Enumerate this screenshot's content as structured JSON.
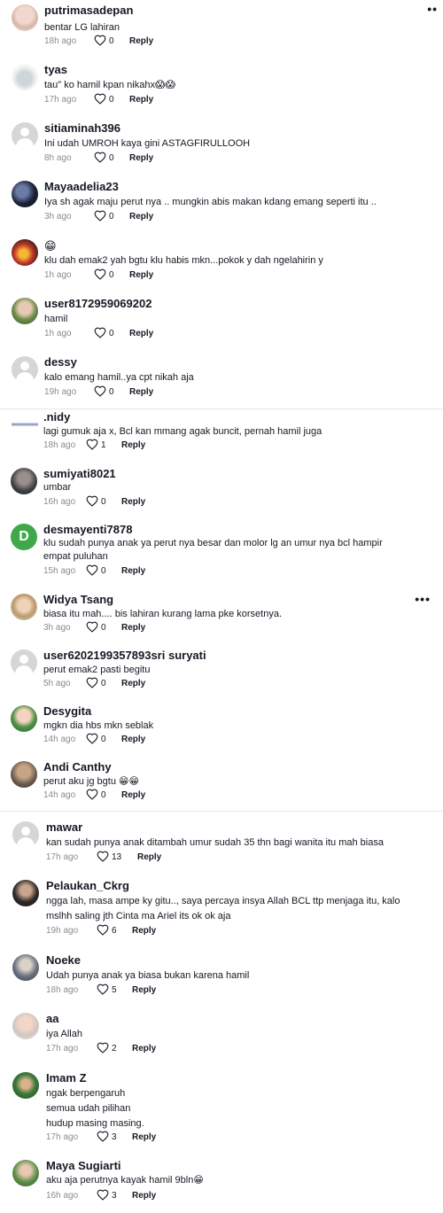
{
  "reply_label": "Reply",
  "comments": [
    {
      "username": "putrimasadepan",
      "text": [
        "bentar LG lahiran"
      ],
      "time": "18h ago",
      "likes": "0",
      "avatar": "pink"
    },
    {
      "username": "tyas",
      "text": [
        "tau\" ko hamil kpan nikahx😱😱"
      ],
      "time": "17h ago",
      "likes": "0",
      "avatar": "tyas"
    },
    {
      "username": "sitiaminah396",
      "text": [
        "Ini udah UMROH kaya gini ASTAGFIRULLOOH"
      ],
      "time": "8h ago",
      "likes": "0",
      "avatar": "gray"
    },
    {
      "username": "Mayaadelia23",
      "text": [
        "Iya sh agak maju perut nya .. mungkin abis makan kdang emang seperti itu .."
      ],
      "time": "3h ago",
      "likes": "0",
      "avatar": "dark"
    },
    {
      "username": "",
      "emoji": "😁",
      "text": [
        "klu dah emak2 yah bgtu klu habis mkn...pokok y dah ngelahirin y"
      ],
      "time": "1h ago",
      "likes": "0",
      "avatar": "fire"
    },
    {
      "username": "user8172959069202",
      "text": [
        "hamil"
      ],
      "time": "1h ago",
      "likes": "0",
      "avatar": "green"
    },
    {
      "username": "dessy",
      "text": [
        "kalo emang hamil..ya cpt nikah aja"
      ],
      "time": "19h ago",
      "likes": "0",
      "avatar": "gray"
    },
    {
      "username": ".nidy",
      "text": [
        "lagi gumuk aja x, Bcl kan mmang agak buncit, pernah hamil juga"
      ],
      "time": "18h ago",
      "likes": "1",
      "avatar": "nidy"
    },
    {
      "username": "sumiyati8021",
      "text": [
        "umbar"
      ],
      "time": "16h ago",
      "likes": "0",
      "avatar": "darkgray"
    },
    {
      "username": "desmayenti7878",
      "text": [
        "klu sudah punya anak ya perut nya besar dan molor lg an umur nya bcl hampir",
        "empat puluhan"
      ],
      "time": "15h ago",
      "likes": "0",
      "avatar": "letter",
      "letter": "D"
    },
    {
      "username": "Widya Tsang",
      "text": [
        "biasa itu mah.... bis lahiran kurang lama pke korsetnya."
      ],
      "time": "3h ago",
      "likes": "0",
      "avatar": "widya",
      "more": "•••"
    },
    {
      "username": "user6202199357893sri suryati",
      "text": [
        "perut emak2 pasti begitu"
      ],
      "time": "5h ago",
      "likes": "0",
      "avatar": "gray"
    },
    {
      "username": "Desygita",
      "text": [
        "mgkn dia hbs mkn seblak"
      ],
      "time": "14h ago",
      "likes": "0",
      "avatar": "desy"
    },
    {
      "username": "Andi Canthy",
      "text": [
        "perut aku jg bgtu 😁😁"
      ],
      "time": "14h ago",
      "likes": "0",
      "avatar": "andi"
    },
    {
      "username": "mawar",
      "text": [
        "kan sudah punya anak ditambah umur sudah 35 thn bagi wanita itu mah biasa"
      ],
      "time": "17h ago",
      "likes": "13",
      "avatar": "gray"
    },
    {
      "username": "Pelaukan_Ckrg",
      "text": [
        "ngga lah, masa ampe ky gitu.., saya percaya insya Allah BCL ttp menjaga itu, kalo",
        "mslhh saling jth Cinta ma Ariel its ok ok aja"
      ],
      "time": "19h ago",
      "likes": "6",
      "avatar": "pelau"
    },
    {
      "username": "Noeke",
      "text": [
        "Udah punya anak ya biasa bukan karena hamil"
      ],
      "time": "18h ago",
      "likes": "5",
      "avatar": "noeke"
    },
    {
      "username": "aa",
      "text": [
        "iya Allah"
      ],
      "time": "17h ago",
      "likes": "2",
      "avatar": "aa"
    },
    {
      "username": "Imam Z",
      "text": [
        "ngak berpengaruh",
        "semua udah pilihan",
        "hudup masing masing."
      ],
      "time": "17h ago",
      "likes": "3",
      "avatar": "imam"
    },
    {
      "username": "Maya Sugiarti",
      "text": [
        "aku aja perutnya kayak hamil 9bln😁"
      ],
      "time": "16h ago",
      "likes": "3",
      "avatar": "maya"
    }
  ],
  "top_more": "••",
  "colors": {
    "meta": "#8a8b91",
    "text": "#161823",
    "divider": "#e6e6e6",
    "letter_avatar": "#3fa84a"
  }
}
